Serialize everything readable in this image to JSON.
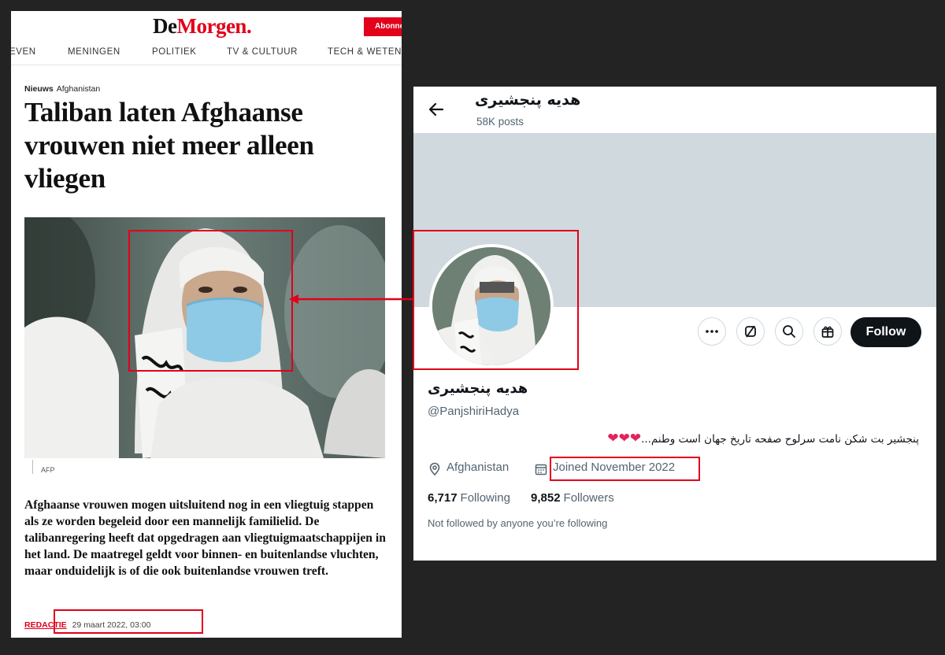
{
  "article": {
    "logo_part1": "De",
    "logo_part2": "Morgen.",
    "subscribe_label": "Abonne",
    "nav": [
      "EVEN",
      "MENINGEN",
      "POLITIEK",
      "TV & CULTUUR",
      "TECH & WETENS"
    ],
    "section": "Nieuws",
    "topic": "Afghanistan",
    "headline": "Taliban laten Afghaanse vrouwen niet meer alleen vliegen",
    "photo_credit": "AFP",
    "lead": "Afghaanse vrouwen mogen uitsluitend nog in een vliegtuig stappen als ze worden begeleid door een mannelijk familielid. De talibanregering heeft dat opgedragen aan vliegtuigmaatschappijen in het land. De maatregel geldt voor binnen- en buitenlandse vluchten, maar onduidelijk is of die ook buitenlandse vrouwen treft.",
    "author": "REDACTIE",
    "date": "29 maart 2022, 03:00"
  },
  "profile": {
    "title": "هدیه پنجشیری",
    "posts": "58K posts",
    "name": "هدیه پنجشیری",
    "handle": "@PanjshiriHadya",
    "bio": "پنجشیر بت شکن نامت سرلوح صفحه تاریخ جهان است وطنم...",
    "bio_hearts": "❤❤❤",
    "location": "Afghanistan",
    "joined": "Joined November 2022",
    "following_count": "6,717",
    "following_label": "Following",
    "followers_count": "9,852",
    "followers_label": "Followers",
    "not_followed": "Not followed by anyone you’re following",
    "follow_label": "Follow"
  },
  "icons": [
    "back-arrow-icon",
    "more-icon",
    "grok-icon",
    "search-icon",
    "gift-icon",
    "location-icon",
    "calendar-icon"
  ],
  "colors": {
    "brand_red": "#e2001a",
    "annotation_red": "#e2001a",
    "follow_button": "#0f1419",
    "banner": "#cfd9de",
    "background": "#232323"
  }
}
